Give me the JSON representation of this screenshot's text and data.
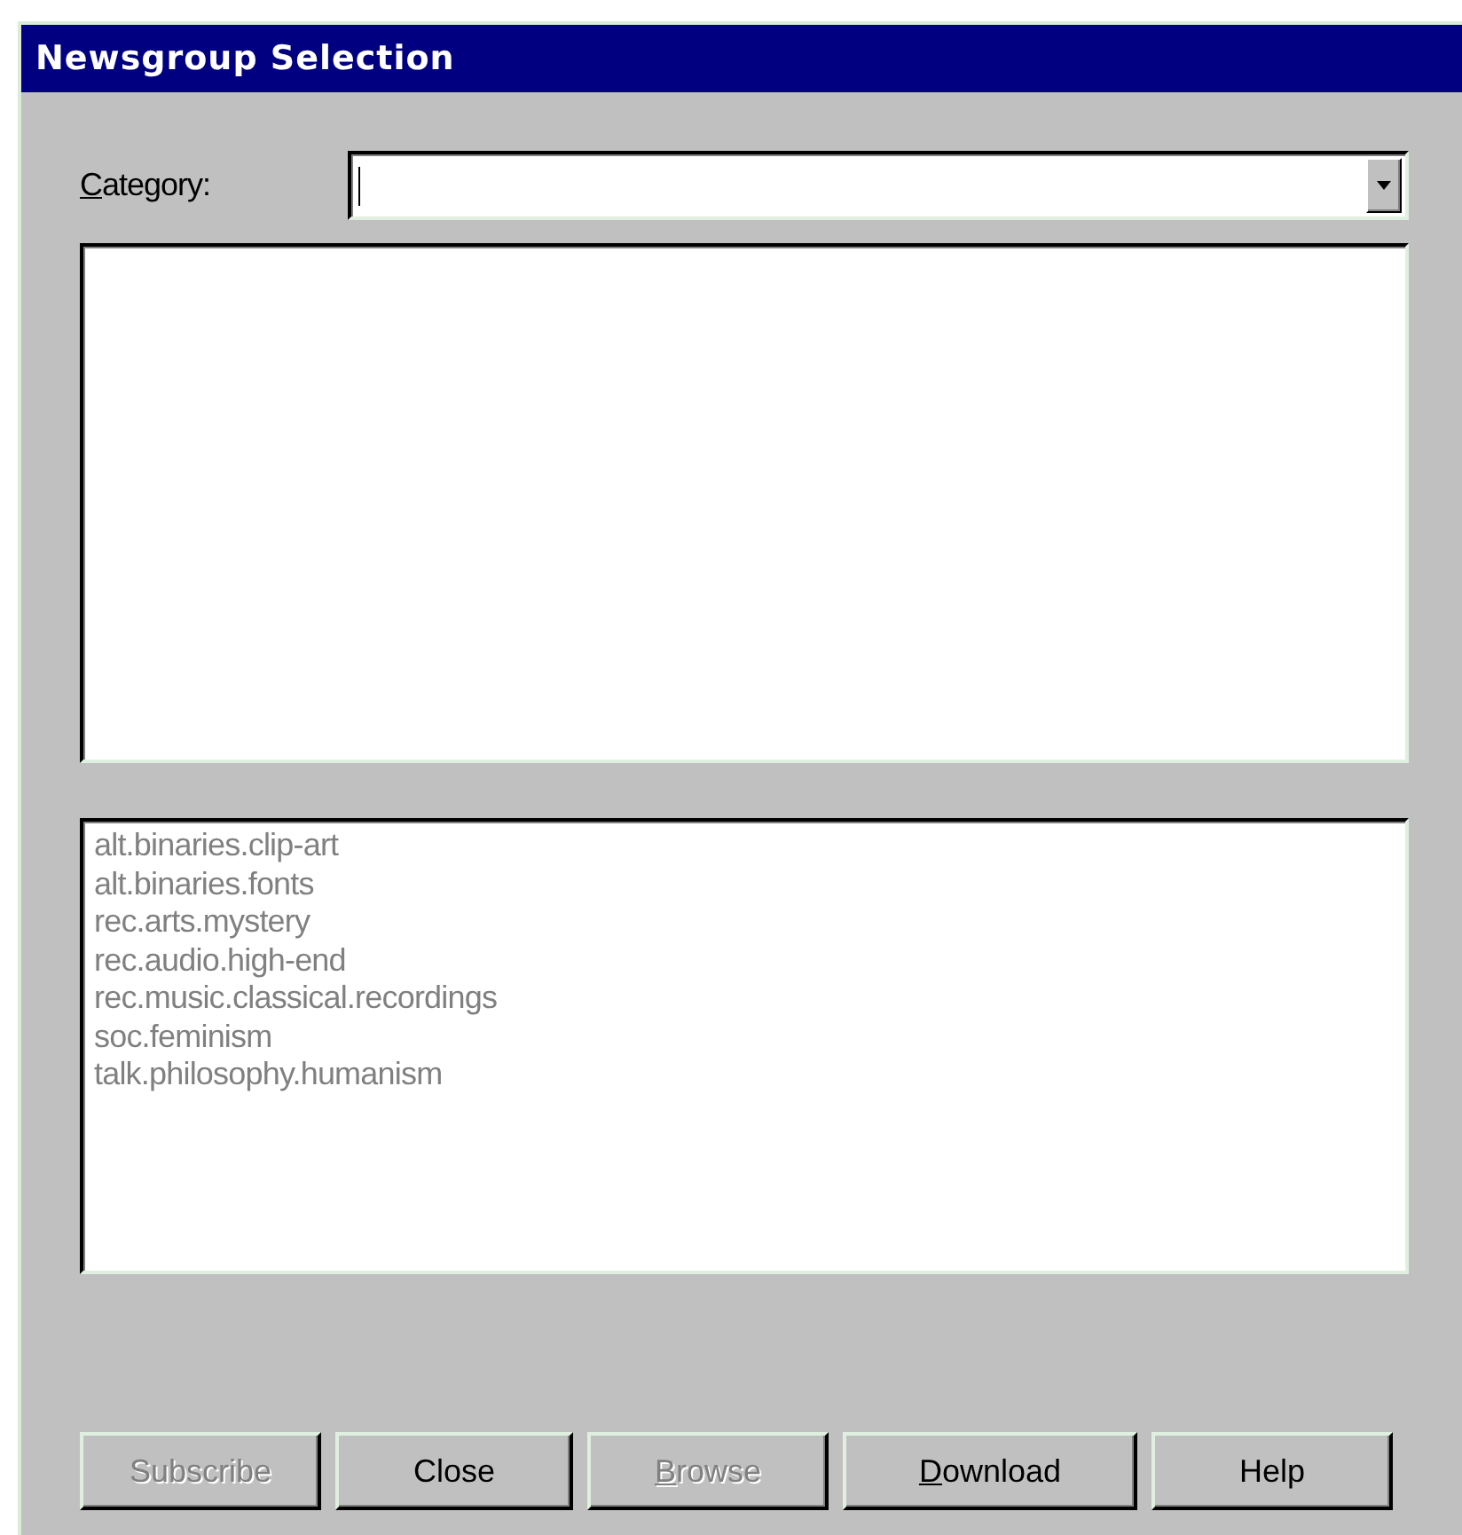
{
  "window": {
    "title": "Newsgroup Selection"
  },
  "category": {
    "label": "Category:",
    "underline_first": true
  },
  "lower_list": {
    "disabled": true,
    "items": [
      {
        "label": "alt.binaries.clip-art"
      },
      {
        "label": "alt.binaries.fonts"
      },
      {
        "label": "rec.arts.mystery"
      },
      {
        "label": "rec.audio.high-end"
      },
      {
        "label": "rec.music.classical.recordings"
      },
      {
        "label": "soc.feminism"
      },
      {
        "label": "talk.philosophy.humanism"
      }
    ]
  },
  "buttons": [
    {
      "label": "Subscribe",
      "disabled": true,
      "underline_first": false
    },
    {
      "label": "Close",
      "disabled": false,
      "underline_first": false
    },
    {
      "label": "Browse",
      "disabled": true,
      "underline_first": true
    },
    {
      "label": "Download",
      "disabled": false,
      "underline_first": true
    },
    {
      "label": "Help",
      "disabled": false,
      "underline_first": false
    }
  ]
}
